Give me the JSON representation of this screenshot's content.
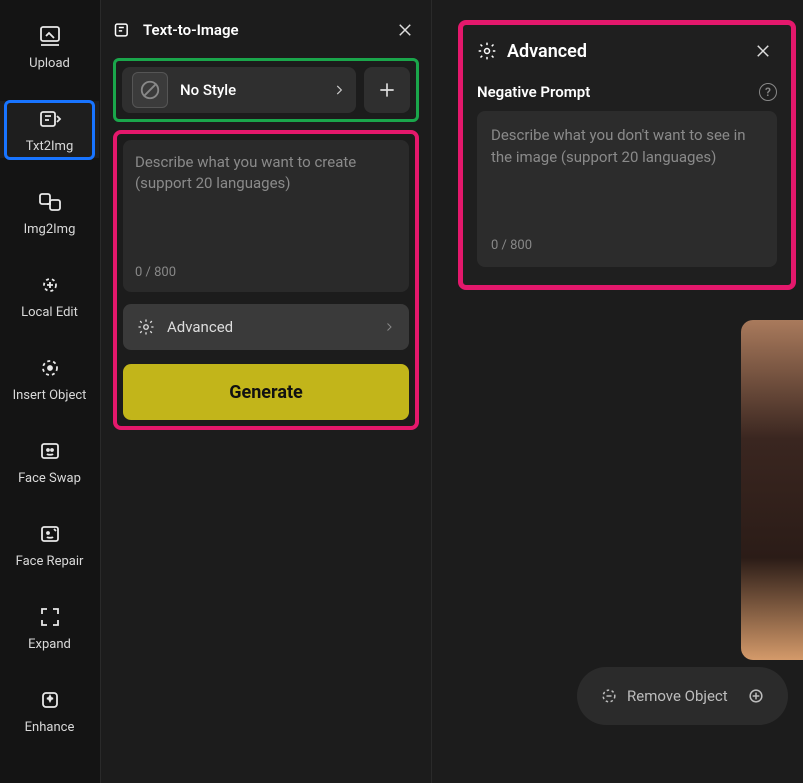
{
  "sidebar": {
    "items": [
      {
        "label": "Upload"
      },
      {
        "label": "Txt2Img"
      },
      {
        "label": "Img2Img"
      },
      {
        "label": "Local Edit"
      },
      {
        "label": "Insert Object"
      },
      {
        "label": "Face Swap"
      },
      {
        "label": "Face Repair"
      },
      {
        "label": "Expand"
      },
      {
        "label": "Enhance"
      }
    ]
  },
  "panel": {
    "title": "Text-to-Image",
    "style_label": "No Style",
    "prompt_placeholder": "Describe what you want to create (support 20 languages)",
    "prompt_counter": "0 / 800",
    "advanced_label": "Advanced",
    "generate_label": "Generate"
  },
  "advanced_panel": {
    "title": "Advanced",
    "negative_label": "Negative Prompt",
    "negative_placeholder": "Describe what you don't want to see in the image (support 20 languages)",
    "negative_counter": "0 / 800"
  },
  "bottom_tools": {
    "remove_object": "Remove Object"
  },
  "colors": {
    "highlight_blue": "#1874ff",
    "highlight_green": "#1aa64b",
    "highlight_pink": "#e4186c",
    "accent_yellow": "#c2b51a"
  }
}
